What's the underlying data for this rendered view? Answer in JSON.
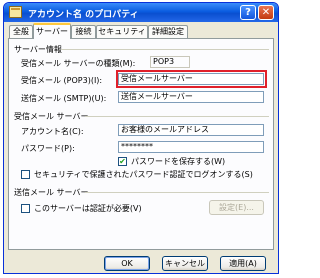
{
  "window": {
    "title": "アカウント名 のプロパティ"
  },
  "tabs": [
    "全般",
    "サーバー",
    "接続",
    "セキュリティ",
    "詳細設定"
  ],
  "server_info": {
    "section_label": "サーバー情報",
    "incoming_type_label": "受信メール サーバーの種類(M):",
    "incoming_type_value": "POP3",
    "incoming_label": "受信メール (POP3)(I):",
    "incoming_value": "受信メールサーバー",
    "outgoing_label": "送信メール (SMTP)(U):",
    "outgoing_value": "送信メールサーバー"
  },
  "incoming_server": {
    "section_label": "受信メール サーバー",
    "account_label": "アカウント名(C):",
    "account_value": "お客様のメールアドレス",
    "password_label": "パスワード(P):",
    "password_value": "********",
    "remember_label": "パスワードを保存する(W)",
    "spa_label": "セキュリティで保護されたパスワード認証でログオンする(S)"
  },
  "outgoing_server": {
    "section_label": "送信メール サーバー",
    "auth_label": "このサーバーは認証が必要(V)",
    "settings_button": "設定(E)..."
  },
  "footer": {
    "ok": "OK",
    "cancel": "キャンセル",
    "apply": "適用(A)"
  }
}
